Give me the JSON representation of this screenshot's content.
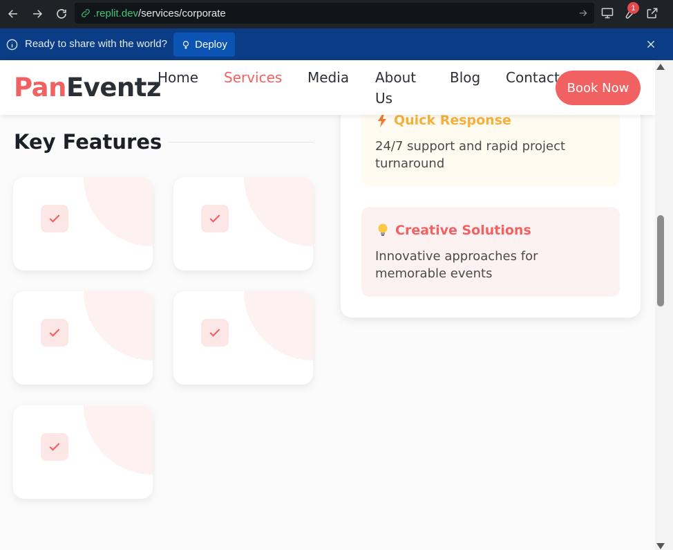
{
  "browser": {
    "url_domain": ".replit.dev",
    "url_path": "/services/corporate",
    "notification_count": "1"
  },
  "banner": {
    "message": "Ready to share with the world?",
    "deploy_label": "Deploy"
  },
  "header": {
    "logo_part1": "Pan",
    "logo_part2": "Eventz",
    "nav": {
      "home": "Home",
      "services": "Services",
      "media": "Media",
      "about_line1": "About",
      "about_line2": "Us",
      "blog": "Blog",
      "contact": "Contact"
    },
    "book_label": "Book Now"
  },
  "key_features": {
    "title": "Key Features",
    "card_count": 5
  },
  "feature_panel": {
    "quick": {
      "title": "Quick Response",
      "icon": "lightning-icon",
      "description": "24/7 support and rapid project turnaround",
      "color": "#f5b13d"
    },
    "creative": {
      "title": "Creative Solutions",
      "icon": "lightbulb-icon",
      "description": "Innovative approaches for memorable events",
      "color": "#f26161"
    }
  },
  "colors": {
    "accent": "#f26161",
    "banner_bg": "#0a3d86",
    "deploy_btn": "#0b54b3"
  }
}
